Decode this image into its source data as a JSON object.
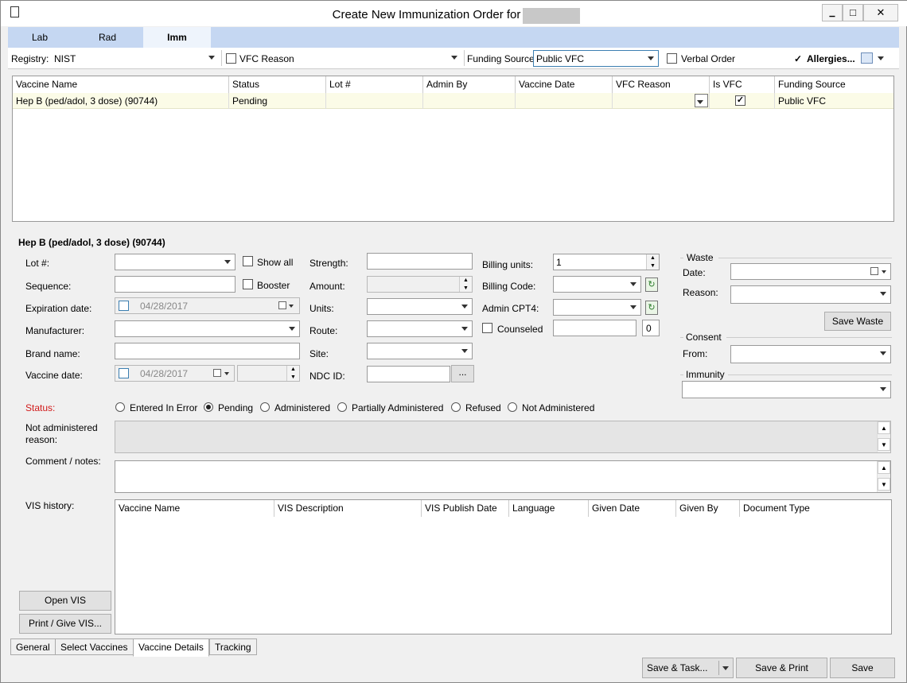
{
  "window": {
    "title": "Create New Immunization Order for",
    "min": "▁",
    "max": "□",
    "close": "✕"
  },
  "tabs": [
    "Lab",
    "Rad",
    "Imm"
  ],
  "registry": {
    "label": "Registry:",
    "value": "NIST",
    "vfc_reason_label": "VFC Reason",
    "funding_label": "Funding Source:",
    "funding_value": "Public VFC",
    "verbal_order": "Verbal Order",
    "allergies": "Allergies...",
    "check": "✓"
  },
  "orders_grid": {
    "headers": [
      "Vaccine Name",
      "Status",
      "Lot #",
      "Admin By",
      "Vaccine Date",
      "VFC Reason",
      "Is VFC",
      "Funding Source"
    ],
    "rows": [
      {
        "vaccine": "Hep B (ped/adol, 3 dose) (90744)",
        "status": "Pending",
        "lot": "",
        "admin_by": "",
        "date": "",
        "vfc_reason": "",
        "is_vfc": "✓",
        "funding": "Public VFC"
      }
    ]
  },
  "details": {
    "heading": "Hep B (ped/adol, 3 dose) (90744)",
    "lot_label": "Lot #:",
    "show_all": "Show all",
    "sequence_label": "Sequence:",
    "booster": "Booster",
    "expiration_label": "Expiration date:",
    "expiration_value": "04/28/2017",
    "manufacturer_label": "Manufacturer:",
    "brand_label": "Brand name:",
    "vaccine_date_label": "Vaccine date:",
    "vaccine_date_value": "04/28/2017",
    "strength_label": "Strength:",
    "amount_label": "Amount:",
    "units_label": "Units:",
    "route_label": "Route:",
    "site_label": "Site:",
    "ndc_label": "NDC ID:",
    "ndc_btn": "...",
    "billing_units_label": "Billing units:",
    "billing_units_value": "1",
    "billing_code_label": "Billing Code:",
    "admin_cpt_label": "Admin CPT4:",
    "counseled": "Counseled",
    "counseled_count": "0",
    "waste_label": "Waste",
    "waste_date_label": "Date:",
    "waste_reason_label": "Reason:",
    "save_waste": "Save Waste",
    "consent_label": "Consent",
    "consent_from_label": "From:",
    "immunity_label": "Immunity",
    "status_label": "Status:",
    "status_options": [
      "Entered In Error",
      "Pending",
      "Administered",
      "Partially Administered",
      "Refused",
      "Not Administered"
    ],
    "status_selected": "Pending",
    "not_admin_label_1": "Not administered",
    "not_admin_label_2": "reason:",
    "comment_label": "Comment / notes:",
    "vis_label": "VIS history:"
  },
  "vis_grid": {
    "headers": [
      "Vaccine Name",
      "VIS Description",
      "VIS Publish Date",
      "Language",
      "Given Date",
      "Given By",
      "Document Type"
    ]
  },
  "buttons": {
    "open_vis": "Open VIS",
    "print_vis": "Print / Give VIS...",
    "save_task": "Save & Task...",
    "save_print": "Save & Print",
    "save": "Save"
  },
  "bottom_tabs": [
    "General",
    "Select Vaccines",
    "Vaccine Details",
    "Tracking"
  ],
  "colors": {
    "tab_bar": "#c5d7f2",
    "status_red": "#d11a1a",
    "row_highlight": "#fbfbe7"
  }
}
